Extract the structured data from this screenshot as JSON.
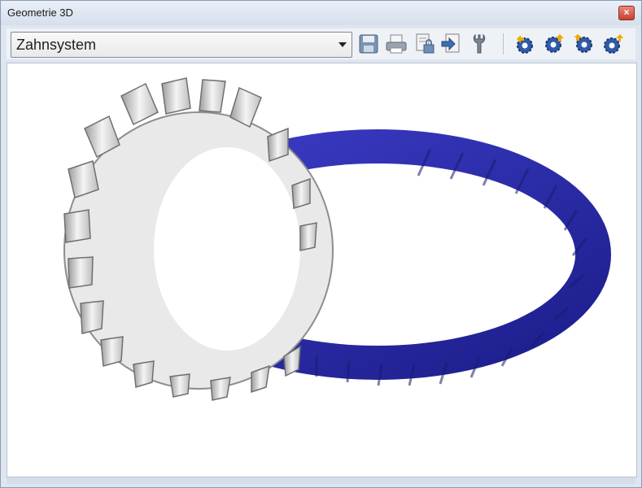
{
  "window": {
    "title": "Geometrie 3D",
    "close_label": "×"
  },
  "toolbar": {
    "selector_value": "Zahnsystem",
    "buttons": [
      {
        "name": "save-icon"
      },
      {
        "name": "print-icon"
      },
      {
        "name": "document-lock-icon"
      },
      {
        "name": "export-icon"
      },
      {
        "name": "wrench-icon"
      },
      {
        "name": "gear-settings-icon-1"
      },
      {
        "name": "gear-settings-icon-2"
      },
      {
        "name": "gear-settings-icon-3"
      },
      {
        "name": "gear-settings-icon-4"
      }
    ]
  },
  "viewport": {
    "content": "3d-gear-mesh",
    "colors": {
      "pinion": "#dcdcdc",
      "ring_gear": "#2a2bb5"
    }
  }
}
